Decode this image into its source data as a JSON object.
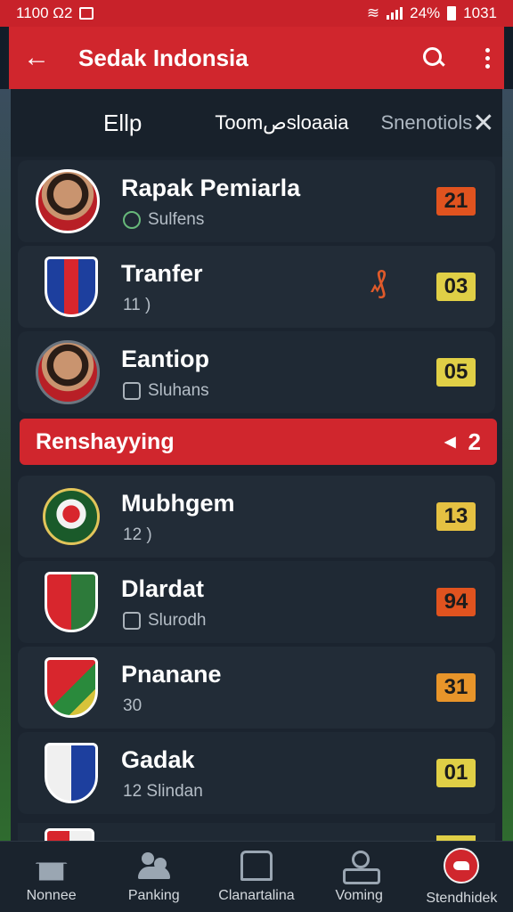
{
  "status_bar": {
    "time": "1100 Ω2",
    "battery": "24%",
    "clock_right": "1031"
  },
  "app_bar": {
    "title": "Sedak Indonsia"
  },
  "tabs": {
    "active": "Ellp",
    "second": "Toomصsloaaia",
    "third": "Snenotiols"
  },
  "rows_top": [
    {
      "name": "Rapak Pemiarla",
      "sub": "Sulfens",
      "score": "21",
      "score_color": "#e0531f"
    },
    {
      "name": "Tranfer",
      "sub": "11  )",
      "mark": "₰",
      "score": "03",
      "score_color": "#e0cf46"
    },
    {
      "name": "Eantiop",
      "sub": "Sluhans",
      "score": "05",
      "score_color": "#e0cf46"
    }
  ],
  "section": {
    "title": "Renshayying",
    "count": "2"
  },
  "rows_bottom": [
    {
      "name": "Mubhgem",
      "sub": "12  )",
      "score": "13",
      "score_color": "#e5c142"
    },
    {
      "name": "Dlardat",
      "sub": "Slurodh",
      "score": "94",
      "score_color": "#e0531f"
    },
    {
      "name": "Pnanane",
      "sub": "30",
      "score": "31",
      "score_color": "#e8952a"
    },
    {
      "name": "Gadak",
      "sub": "12  Slindan",
      "score": "01",
      "score_color": "#e0cf46"
    }
  ],
  "bottom_nav": [
    {
      "label": "Nonnee",
      "icon": "home-icon"
    },
    {
      "label": "Panking",
      "icon": "people-icon"
    },
    {
      "label": "Clanartalina",
      "icon": "chair-icon"
    },
    {
      "label": "Voming",
      "icon": "voting-icon"
    },
    {
      "label": "Stendhidek",
      "icon": "brand-icon"
    }
  ],
  "colors": {
    "brand_red": "#d0262d",
    "panel_bg": "#1b242f"
  }
}
